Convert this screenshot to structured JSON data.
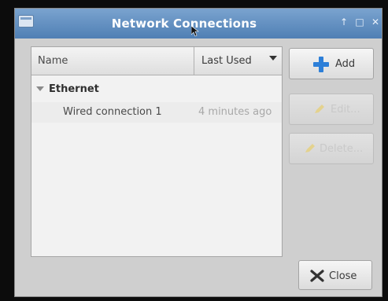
{
  "window": {
    "title": "Network Connections",
    "controls": {
      "up_arrow": "↑",
      "maximize": "□",
      "close": "✕"
    }
  },
  "list": {
    "columns": {
      "name": "Name",
      "last_used": "Last Used"
    },
    "groups": [
      {
        "label": "Ethernet",
        "expanded": true,
        "connections": [
          {
            "name": "Wired connection 1",
            "last_used": "4 minutes ago"
          }
        ]
      }
    ]
  },
  "buttons": {
    "add": {
      "label": "Add",
      "enabled": true,
      "icon": "plus-icon"
    },
    "edit": {
      "label": "Edit...",
      "enabled": false,
      "icon": "edit-icon"
    },
    "delete": {
      "label": "Delete...",
      "enabled": false,
      "icon": "delete-icon"
    },
    "close": {
      "label": "Close",
      "enabled": true,
      "icon": "close-x-icon"
    }
  },
  "colors": {
    "titlebar": "#4f7fb4",
    "plus_icon": "#2d7fd8",
    "disabled_text": "#c9c9c9"
  }
}
